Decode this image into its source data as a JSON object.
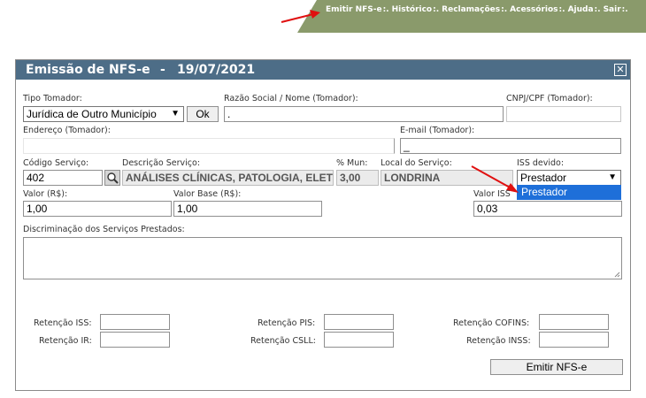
{
  "nav": {
    "items": [
      "Emitir NFS-e",
      "Histórico",
      "Reclamações",
      "Acessórios",
      "Ajuda",
      "Sair"
    ],
    "separator": ":.",
    "bg_color": "#8a9a6b"
  },
  "window": {
    "title": "Emissão de NFS-e",
    "dash": "-",
    "date": "19/07/2021",
    "close_symbol": "✕",
    "title_color": "#4d6d87"
  },
  "form": {
    "tipo_tomador": {
      "label": "Tipo Tomador:",
      "value": "Jurídica de Outro Município"
    },
    "ok_button": "Ok",
    "razao_social": {
      "label": "Razão Social / Nome (Tomador):",
      "value": "."
    },
    "cnpj": {
      "label": "CNPJ/CPF (Tomador):",
      "value": ""
    },
    "endereco": {
      "label": "Endereço (Tomador):",
      "value": ""
    },
    "email": {
      "label": "E-mail (Tomador):",
      "value": "_"
    },
    "codigo_servico": {
      "label": "Código Serviço:",
      "value": "402"
    },
    "descricao_servico": {
      "label": "Descrição Serviço:",
      "value": "ANÁLISES CLÍNICAS, PATOLOGIA, ELET"
    },
    "pct_mun": {
      "label": "% Mun:",
      "value": "3,00"
    },
    "local_servico": {
      "label": "Local do Serviço:",
      "value": "LONDRINA"
    },
    "iss_devido": {
      "label": "ISS devido:",
      "value": "Prestador",
      "options": [
        "Prestador"
      ]
    },
    "valor": {
      "label": "Valor (R$):",
      "value": "1,00"
    },
    "valor_base": {
      "label": "Valor Base (R$):",
      "value": "1,00"
    },
    "valor_iss": {
      "label": "Valor ISS",
      "value": "0,03"
    },
    "discriminacao": {
      "label": "Discriminação dos Serviços Prestados:",
      "value": ""
    },
    "retencao_iss": {
      "label": "Retenção ISS:",
      "value": ""
    },
    "retencao_ir": {
      "label": "Retenção IR:",
      "value": ""
    },
    "retencao_pis": {
      "label": "Retenção PIS:",
      "value": ""
    },
    "retencao_csll": {
      "label": "Retenção CSLL:",
      "value": ""
    },
    "retencao_cofins": {
      "label": "Retenção COFINS:",
      "value": ""
    },
    "retencao_inss": {
      "label": "Retenção INSS:",
      "value": ""
    },
    "emitir_button": "Emitir NFS-e"
  },
  "icons": {
    "search": "search-icon",
    "arrow": "arrow-icon",
    "dropdown": "chevron-down-icon"
  }
}
